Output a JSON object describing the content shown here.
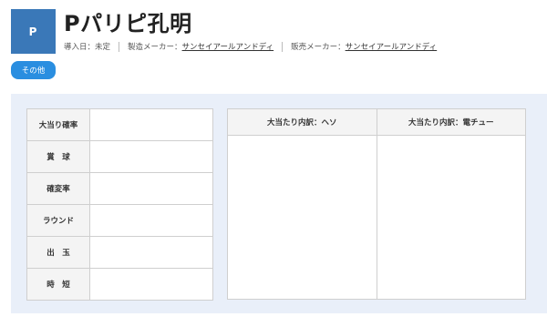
{
  "header": {
    "logo_text": "P",
    "title": "Pパリピ孔明",
    "meta": {
      "introduced_label": "導入日：",
      "introduced_value": "未定",
      "maker_label": "製造メーカー：",
      "maker_value": "サンセイアールアンドディ",
      "seller_label": "販売メーカー：",
      "seller_value": "サンセイアールアンドディ"
    }
  },
  "other_button_label": "その他",
  "spec_table": {
    "rows": [
      {
        "label": "大当り確率",
        "value": ""
      },
      {
        "label": "賞　球",
        "value": ""
      },
      {
        "label": "確変率",
        "value": ""
      },
      {
        "label": "ラウンド",
        "value": ""
      },
      {
        "label": "出　玉",
        "value": ""
      },
      {
        "label": "時　短",
        "value": ""
      }
    ]
  },
  "breakdown_table": {
    "headers": [
      "大当たり内訳：ヘソ",
      "大当たり内訳：電チュー"
    ],
    "cells": [
      "",
      ""
    ]
  },
  "colors": {
    "logo_bg": "#3a78b8",
    "button_bg": "#2a8ee0",
    "panel_bg": "#e9eff9"
  }
}
